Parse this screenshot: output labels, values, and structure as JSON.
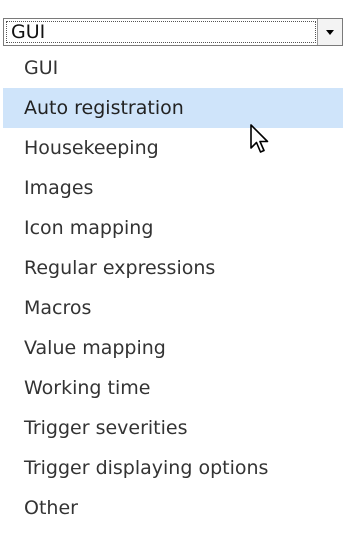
{
  "select": {
    "value": "GUI"
  },
  "options": [
    {
      "label": "GUI",
      "state": "normal"
    },
    {
      "label": "Auto registration",
      "state": "hover"
    },
    {
      "label": "Housekeeping",
      "state": "normal"
    },
    {
      "label": "Images",
      "state": "normal"
    },
    {
      "label": "Icon mapping",
      "state": "normal"
    },
    {
      "label": "Regular expressions",
      "state": "normal"
    },
    {
      "label": "Macros",
      "state": "normal"
    },
    {
      "label": "Value mapping",
      "state": "normal"
    },
    {
      "label": "Working time",
      "state": "normal"
    },
    {
      "label": "Trigger severities",
      "state": "normal"
    },
    {
      "label": "Trigger displaying options",
      "state": "normal"
    },
    {
      "label": "Other",
      "state": "normal"
    }
  ],
  "colors": {
    "hover_background": "#cfe4fa",
    "text": "#333333"
  },
  "icons": {
    "dropdown_arrow": "chevron-down-icon",
    "cursor": "mouse-pointer-icon"
  }
}
